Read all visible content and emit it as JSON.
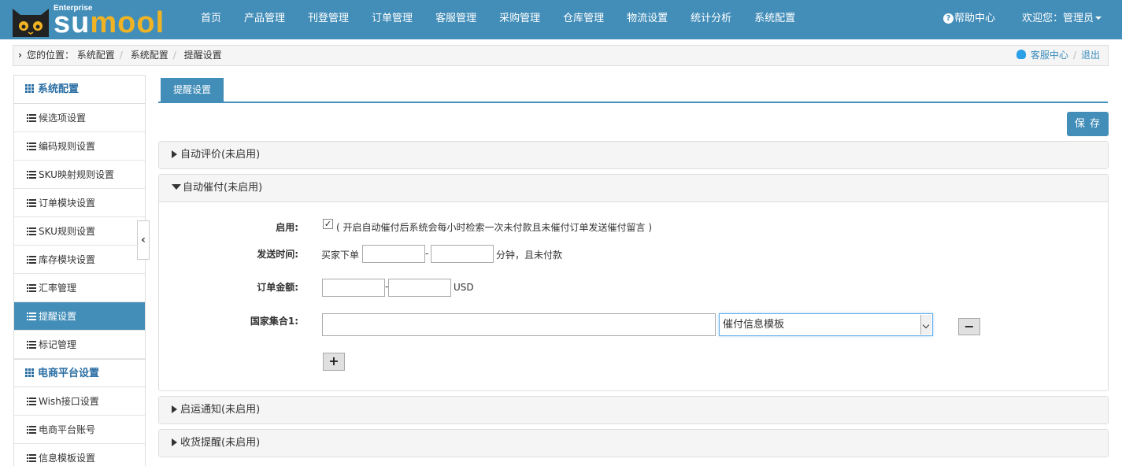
{
  "brand": {
    "enterprise": "Enterprise",
    "name_part1": "su",
    "name_part2": "mool"
  },
  "nav": [
    "首页",
    "产品管理",
    "刊登管理",
    "订单管理",
    "客服管理",
    "采购管理",
    "仓库管理",
    "物流设置",
    "统计分析",
    "系统配置"
  ],
  "help_label": "帮助中心",
  "welcome_label": "欢迎您：管理员",
  "breadcrumb": {
    "prefix": "您的位置：",
    "items": [
      "系统配置",
      "系统配置",
      "提醒设置"
    ],
    "service_link": "客服中心",
    "logout_link": "退出"
  },
  "sidebar": {
    "group1": "系统配置",
    "items1": [
      "候选项设置",
      "编码规则设置",
      "SKU映射规则设置",
      "订单模块设置",
      "SKU规则设置",
      "库存模块设置",
      "汇率管理",
      "提醒设置",
      "标记管理"
    ],
    "active_index": 7,
    "group2": "电商平台设置",
    "items2": [
      "Wish接口设置",
      "电商平台账号",
      "信息模板设置"
    ]
  },
  "main": {
    "tab": "提醒设置",
    "save_label": "保 存",
    "panels": {
      "auto_review": "自动评价(未启用)",
      "auto_payment": "自动催付(未启用)",
      "shipping_notice": "启运通知(未启用)",
      "receipt_reminder": "收货提醒(未启用)"
    },
    "form": {
      "enable_label": "启用:",
      "enable_checked": true,
      "enable_note": "( 开启自动催付后系统会每小时检索一次未付款且未催付订单发送催付留言 )",
      "send_time_label": "发送时间:",
      "send_time_prefix": "买家下单",
      "send_time_dash": "-",
      "send_time_suffix": "分钟，且未付款",
      "send_time_from": "",
      "send_time_to": "",
      "amount_label": "订单金额:",
      "amount_dash": "-",
      "amount_from": "",
      "amount_to": "",
      "amount_unit": "USD",
      "country_label": "国家集合1:",
      "country_value": "",
      "template_selected": "催付信息模板",
      "remove_symbol": "−",
      "add_symbol": "+"
    }
  },
  "colors": {
    "primary": "#438eb9",
    "logo_accent": "#f0b323"
  },
  "icons": {
    "help": "help-circle-icon",
    "service": "qq-penguin-icon",
    "collapse": "chevron-left-icon"
  }
}
